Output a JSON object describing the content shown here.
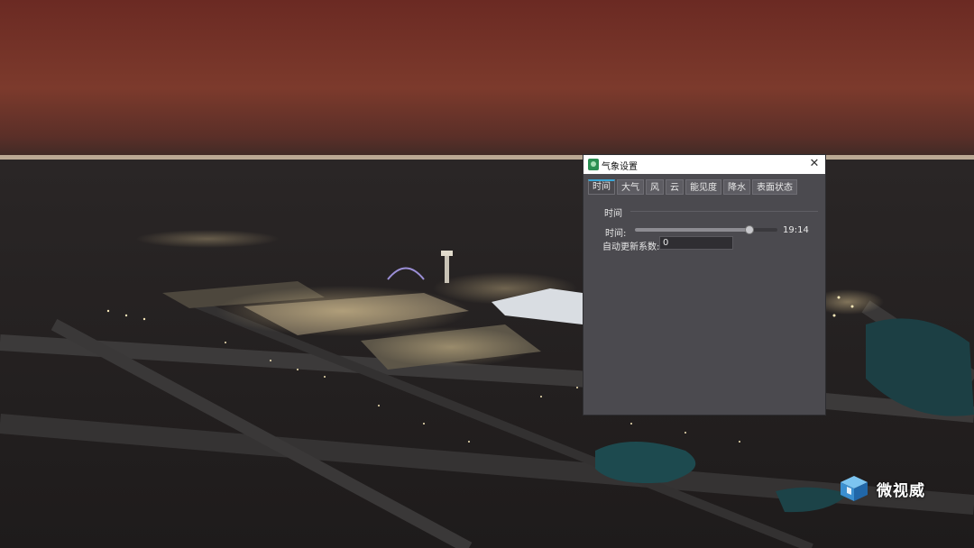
{
  "window": {
    "title": "气象设置",
    "close_glyph": "✕"
  },
  "tabs": [
    {
      "label": "时间",
      "active": true
    },
    {
      "label": "大气",
      "active": false
    },
    {
      "label": "风",
      "active": false
    },
    {
      "label": "云",
      "active": false
    },
    {
      "label": "能见度",
      "active": false
    },
    {
      "label": "降水",
      "active": false
    },
    {
      "label": "表面状态",
      "active": false
    }
  ],
  "time_panel": {
    "group_title": "时间",
    "time_label": "时间:",
    "time_value": "19:14",
    "slider_fraction": 0.8,
    "coef_label": "自动更新系数:",
    "coef_value": "0"
  },
  "watermark": {
    "text": "微视威"
  },
  "colors": {
    "accent_tab": "#39a6d6",
    "dialog_bg": "#4b4a4f",
    "app_icon": "#2a8f52"
  }
}
